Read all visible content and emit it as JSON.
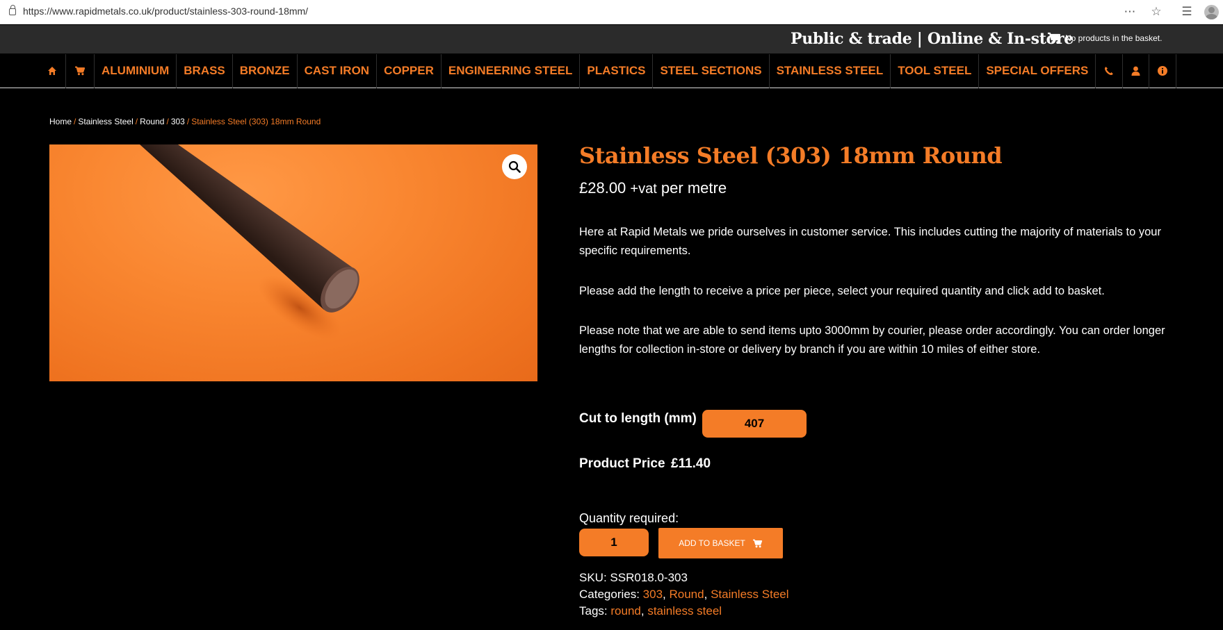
{
  "browser": {
    "url": "https://www.rapidmetals.co.uk/product/stainless-303-round-18mm/"
  },
  "topbar": {
    "tagline": "Public & trade | Online & In-store",
    "basket_status": "No products in the basket."
  },
  "nav": {
    "items": [
      "ALUMINIUM",
      "BRASS",
      "BRONZE",
      "CAST IRON",
      "COPPER",
      "ENGINEERING STEEL",
      "PLASTICS",
      "STEEL SECTIONS",
      "STAINLESS STEEL",
      "TOOL STEEL",
      "SPECIAL OFFERS"
    ],
    "icons": [
      "home-icon",
      "cart-icon",
      "phone-icon",
      "account-icon",
      "info-icon"
    ]
  },
  "breadcrumb": {
    "items": [
      "Home",
      "Stainless Steel",
      "Round",
      "303"
    ],
    "current": "Stainless Steel (303) 18mm Round",
    "separator": "/"
  },
  "product": {
    "title": "Stainless Steel (303) 18mm Round",
    "price": "£28.00",
    "price_suffix_vat": "+vat",
    "price_suffix_unit": "per metre",
    "description": [
      "Here at Rapid Metals we pride ourselves in customer service. This includes cutting the majority of materials to your specific requirements.",
      "Please add the length to receive a price per piece, select your required quantity and click add to basket.",
      "Please note that we are able to send items upto 3000mm by courier, please order accordingly. You can order longer lengths for collection in-store or delivery by branch if you are within 10 miles of either store."
    ],
    "cut_label": "Cut to length (mm)",
    "cut_value": "407",
    "product_price_label": "Product Price",
    "product_price_value": "£11.40",
    "quantity_label": "Quantity required:",
    "quantity_value": "1",
    "add_button": "ADD TO BASKET",
    "sku_label": "SKU:",
    "sku_value": "SSR018.0-303",
    "categories_label": "Categories:",
    "categories": [
      "303",
      "Round",
      "Stainless Steel"
    ],
    "tags_label": "Tags:",
    "tags": [
      "round",
      "stainless steel"
    ]
  },
  "colors": {
    "accent": "#f47c27",
    "background": "#000000",
    "topstrip": "#2b2b2b"
  }
}
